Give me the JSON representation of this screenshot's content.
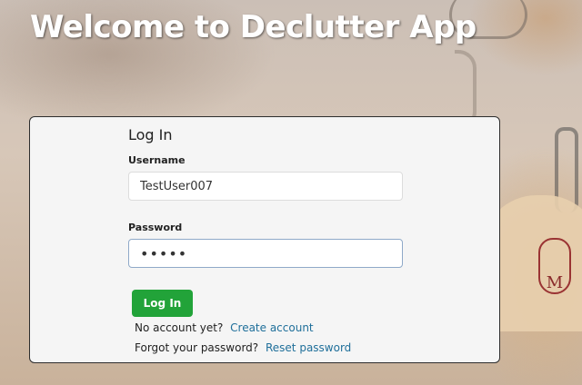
{
  "header": {
    "title": "Welcome to Declutter App"
  },
  "background": {
    "logo_letter": "M"
  },
  "login": {
    "heading": "Log In",
    "username_label": "Username",
    "username_value": "TestUser007",
    "password_label": "Password",
    "password_value": "•••••",
    "button_label": "Log In",
    "no_account_text": "No account yet?",
    "create_account_link": "Create account",
    "forgot_password_text": "Forgot your password?",
    "reset_password_link": "Reset password"
  },
  "colors": {
    "button": "#22a339",
    "link": "#1f6f9a",
    "card_background": "#f5f5f5"
  }
}
